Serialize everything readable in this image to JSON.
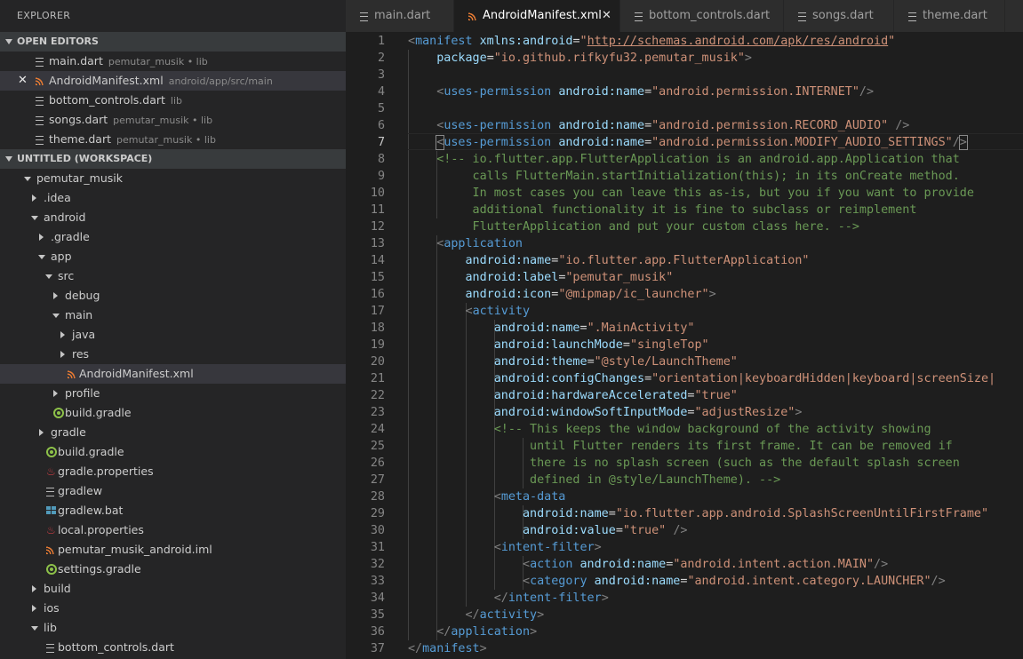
{
  "explorer": {
    "title": "EXPLORER",
    "open_editors_title": "OPEN EDITORS",
    "workspace_title": "UNTITLED (WORKSPACE)",
    "open_editors": [
      {
        "name": "main.dart",
        "desc": "pemutar_musik • lib",
        "icon": "dart-file-icon"
      },
      {
        "name": "AndroidManifest.xml",
        "desc": "android/app/src/main",
        "icon": "xml-file-icon",
        "active": true
      },
      {
        "name": "bottom_controls.dart",
        "desc": "lib",
        "icon": "dart-file-icon"
      },
      {
        "name": "songs.dart",
        "desc": "pemutar_musik • lib",
        "icon": "dart-file-icon"
      },
      {
        "name": "theme.dart",
        "desc": "pemutar_musik • lib",
        "icon": "dart-file-icon"
      }
    ],
    "tree": [
      {
        "name": "pemutar_musik",
        "type": "folder-open"
      },
      {
        "name": ".idea",
        "type": "folder"
      },
      {
        "name": "android",
        "type": "folder-open"
      },
      {
        "name": ".gradle",
        "type": "folder"
      },
      {
        "name": "app",
        "type": "folder-open"
      },
      {
        "name": "src",
        "type": "folder-open"
      },
      {
        "name": "debug",
        "type": "folder"
      },
      {
        "name": "main",
        "type": "folder-open"
      },
      {
        "name": "java",
        "type": "folder"
      },
      {
        "name": "res",
        "type": "folder"
      },
      {
        "name": "AndroidManifest.xml",
        "type": "xml"
      },
      {
        "name": "profile",
        "type": "folder"
      },
      {
        "name": "build.gradle",
        "type": "gradle"
      },
      {
        "name": "gradle",
        "type": "folder"
      },
      {
        "name": "build.gradle",
        "type": "gradle"
      },
      {
        "name": "gradle.properties",
        "type": "java"
      },
      {
        "name": "gradlew",
        "type": "file"
      },
      {
        "name": "gradlew.bat",
        "type": "windows"
      },
      {
        "name": "local.properties",
        "type": "java"
      },
      {
        "name": "pemutar_musik_android.iml",
        "type": "xml"
      },
      {
        "name": "settings.gradle",
        "type": "gradle"
      },
      {
        "name": "build",
        "type": "folder"
      },
      {
        "name": "ios",
        "type": "folder"
      },
      {
        "name": "lib",
        "type": "folder-open"
      },
      {
        "name": "bottom_controls.dart",
        "type": "file"
      }
    ]
  },
  "tabs": [
    {
      "label": "main.dart",
      "icon": "dart-file-icon"
    },
    {
      "label": "AndroidManifest.xml",
      "icon": "xml-file-icon",
      "active": true,
      "close": "✕"
    },
    {
      "label": "bottom_controls.dart",
      "icon": "dart-file-icon"
    },
    {
      "label": "songs.dart",
      "icon": "dart-file-icon"
    },
    {
      "label": "theme.dart",
      "icon": "dart-file-icon"
    }
  ],
  "editor": {
    "current_line": 7,
    "lines": [
      [
        [
          "p",
          "<"
        ],
        [
          "g",
          "manifest"
        ],
        [
          "d",
          " "
        ],
        [
          "a",
          "xmlns:android"
        ],
        [
          "d",
          "="
        ],
        [
          "v",
          "\""
        ],
        [
          "u",
          "http://schemas.android.com/apk/res/android"
        ],
        [
          "v",
          "\""
        ]
      ],
      [
        [
          "d",
          "    "
        ],
        [
          "a",
          "package"
        ],
        [
          "d",
          "="
        ],
        [
          "v",
          "\"io.github.rifkyfu32.pemutar_musik\""
        ],
        [
          "p",
          ">"
        ]
      ],
      [],
      [
        [
          "d",
          "    "
        ],
        [
          "p",
          "<"
        ],
        [
          "g",
          "uses-permission"
        ],
        [
          "d",
          " "
        ],
        [
          "a",
          "android:name"
        ],
        [
          "d",
          "="
        ],
        [
          "v",
          "\"android.permission.INTERNET\""
        ],
        [
          "p",
          "/>"
        ]
      ],
      [],
      [
        [
          "d",
          "    "
        ],
        [
          "p",
          "<"
        ],
        [
          "g",
          "uses-permission"
        ],
        [
          "d",
          " "
        ],
        [
          "a",
          "android:name"
        ],
        [
          "d",
          "="
        ],
        [
          "v",
          "\"android.permission.RECORD_AUDIO\""
        ],
        [
          "d",
          " "
        ],
        [
          "p",
          "/>"
        ]
      ],
      [
        [
          "d",
          "    "
        ],
        [
          "b",
          "<"
        ],
        [
          "g",
          "uses-permission"
        ],
        [
          "d",
          " "
        ],
        [
          "a",
          "android:name"
        ],
        [
          "d",
          "="
        ],
        [
          "v",
          "\"android.permission.MODIFY_AUDIO_SETTINGS\""
        ],
        [
          "p",
          "/"
        ],
        [
          "b",
          ">"
        ]
      ],
      [
        [
          "d",
          "    "
        ],
        [
          "c",
          "<!-- io.flutter.app.FlutterApplication is an android.app.Application that"
        ]
      ],
      [
        [
          "c",
          "         calls FlutterMain.startInitialization(this); in its onCreate method."
        ]
      ],
      [
        [
          "c",
          "         In most cases you can leave this as-is, but you if you want to provide"
        ]
      ],
      [
        [
          "c",
          "         additional functionality it is fine to subclass or reimplement"
        ]
      ],
      [
        [
          "c",
          "         FlutterApplication and put your custom class here. -->"
        ]
      ],
      [
        [
          "d",
          "    "
        ],
        [
          "p",
          "<"
        ],
        [
          "g",
          "application"
        ]
      ],
      [
        [
          "d",
          "        "
        ],
        [
          "a",
          "android:name"
        ],
        [
          "d",
          "="
        ],
        [
          "v",
          "\"io.flutter.app.FlutterApplication\""
        ]
      ],
      [
        [
          "d",
          "        "
        ],
        [
          "a",
          "android:label"
        ],
        [
          "d",
          "="
        ],
        [
          "v",
          "\"pemutar_musik\""
        ]
      ],
      [
        [
          "d",
          "        "
        ],
        [
          "a",
          "android:icon"
        ],
        [
          "d",
          "="
        ],
        [
          "v",
          "\"@mipmap/ic_launcher\""
        ],
        [
          "p",
          ">"
        ]
      ],
      [
        [
          "d",
          "        "
        ],
        [
          "p",
          "<"
        ],
        [
          "g",
          "activity"
        ]
      ],
      [
        [
          "d",
          "            "
        ],
        [
          "a",
          "android:name"
        ],
        [
          "d",
          "="
        ],
        [
          "v",
          "\".MainActivity\""
        ]
      ],
      [
        [
          "d",
          "            "
        ],
        [
          "a",
          "android:launchMode"
        ],
        [
          "d",
          "="
        ],
        [
          "v",
          "\"singleTop\""
        ]
      ],
      [
        [
          "d",
          "            "
        ],
        [
          "a",
          "android:theme"
        ],
        [
          "d",
          "="
        ],
        [
          "v",
          "\"@style/LaunchTheme\""
        ]
      ],
      [
        [
          "d",
          "            "
        ],
        [
          "a",
          "android:configChanges"
        ],
        [
          "d",
          "="
        ],
        [
          "v",
          "\"orientation|keyboardHidden|keyboard|screenSize|"
        ]
      ],
      [
        [
          "d",
          "            "
        ],
        [
          "a",
          "android:hardwareAccelerated"
        ],
        [
          "d",
          "="
        ],
        [
          "v",
          "\"true\""
        ]
      ],
      [
        [
          "d",
          "            "
        ],
        [
          "a",
          "android:windowSoftInputMode"
        ],
        [
          "d",
          "="
        ],
        [
          "v",
          "\"adjustResize\""
        ],
        [
          "p",
          ">"
        ]
      ],
      [
        [
          "d",
          "            "
        ],
        [
          "c",
          "<!-- This keeps the window background of the activity showing"
        ]
      ],
      [
        [
          "c",
          "                 until Flutter renders its first frame. It can be removed if"
        ]
      ],
      [
        [
          "c",
          "                 there is no splash screen (such as the default splash screen"
        ]
      ],
      [
        [
          "c",
          "                 defined in @style/LaunchTheme). -->"
        ]
      ],
      [
        [
          "d",
          "            "
        ],
        [
          "p",
          "<"
        ],
        [
          "g",
          "meta-data"
        ]
      ],
      [
        [
          "d",
          "                "
        ],
        [
          "a",
          "android:name"
        ],
        [
          "d",
          "="
        ],
        [
          "v",
          "\"io.flutter.app.android.SplashScreenUntilFirstFrame\""
        ]
      ],
      [
        [
          "d",
          "                "
        ],
        [
          "a",
          "android:value"
        ],
        [
          "d",
          "="
        ],
        [
          "v",
          "\"true\""
        ],
        [
          "d",
          " "
        ],
        [
          "p",
          "/>"
        ]
      ],
      [
        [
          "d",
          "            "
        ],
        [
          "p",
          "<"
        ],
        [
          "g",
          "intent-filter"
        ],
        [
          "p",
          ">"
        ]
      ],
      [
        [
          "d",
          "                "
        ],
        [
          "p",
          "<"
        ],
        [
          "g",
          "action"
        ],
        [
          "d",
          " "
        ],
        [
          "a",
          "android:name"
        ],
        [
          "d",
          "="
        ],
        [
          "v",
          "\"android.intent.action.MAIN\""
        ],
        [
          "p",
          "/>"
        ]
      ],
      [
        [
          "d",
          "                "
        ],
        [
          "p",
          "<"
        ],
        [
          "g",
          "category"
        ],
        [
          "d",
          " "
        ],
        [
          "a",
          "android:name"
        ],
        [
          "d",
          "="
        ],
        [
          "v",
          "\"android.intent.category.LAUNCHER\""
        ],
        [
          "p",
          "/>"
        ]
      ],
      [
        [
          "d",
          "            "
        ],
        [
          "p",
          "</"
        ],
        [
          "g",
          "intent-filter"
        ],
        [
          "p",
          ">"
        ]
      ],
      [
        [
          "d",
          "        "
        ],
        [
          "p",
          "</"
        ],
        [
          "g",
          "activity"
        ],
        [
          "p",
          ">"
        ]
      ],
      [
        [
          "d",
          "    "
        ],
        [
          "p",
          "</"
        ],
        [
          "g",
          "application"
        ],
        [
          "p",
          ">"
        ]
      ],
      [
        [
          "p",
          "</"
        ],
        [
          "g",
          "manifest"
        ],
        [
          "p",
          ">"
        ]
      ]
    ]
  },
  "colors": {
    "sidebar_bg": "#252526",
    "editor_bg": "#1e1e1e",
    "tag": "#569cd6",
    "attr": "#9cdcfe",
    "string": "#ce9178",
    "comment": "#6a9955"
  }
}
